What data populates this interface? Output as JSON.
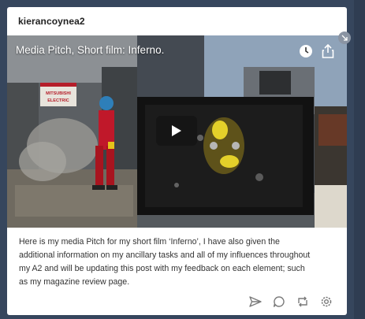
{
  "post": {
    "blog_name": "kierancoynea2",
    "video_title": "Media Pitch, Short film: Inferno.",
    "caption_lines": [
      "Here is my media Pitch for my short film ‘Inferno’, I have also given the",
      "additional information on my ancillary tasks and all of my influences throughout",
      "my A2 and will be updating this post with my feedback on each element; such",
      "as my magazine review page."
    ],
    "sign_line1": "MITSUBISHI",
    "sign_line2": "ELECTRIC"
  },
  "icons": {
    "watch_later": "clock-icon",
    "share": "share-icon",
    "play": "play-icon",
    "corner": "arrow-diagonal-icon",
    "send": "send-icon",
    "reply": "reply-icon",
    "reblog": "reblog-icon",
    "settings": "gear-icon"
  },
  "colors": {
    "background": "#36465d",
    "card": "#ffffff",
    "worker_suit": "#c0182a"
  }
}
